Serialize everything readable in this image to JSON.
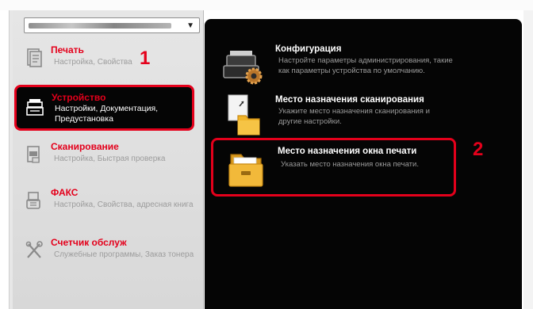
{
  "device_dropdown": {
    "value": "",
    "arrow": "▼"
  },
  "nav": {
    "items": [
      {
        "id": "print",
        "title": "Печать",
        "subtitle": "Настройка, Свойства"
      },
      {
        "id": "device",
        "title": "Устройство",
        "subtitle": "Настройки, Документация, Предустановка"
      },
      {
        "id": "scan",
        "title": "Сканирование",
        "subtitle": "Настройка, Быстрая проверка"
      },
      {
        "id": "fax",
        "title": "ФАКС",
        "subtitle": "Настройка, Свойства, адресная книга"
      },
      {
        "id": "counter",
        "title": "Счетчик обслуж",
        "subtitle": "Служебные программы, Заказ тонера"
      }
    ],
    "selected": "device"
  },
  "main": {
    "cards": [
      {
        "id": "configuration",
        "title": "Конфигурация",
        "description": "Настройте параметры администрирования, такие как параметры устройства по умолчанию."
      },
      {
        "id": "scan_destination",
        "title": "Место назначения сканирования",
        "description": "Укажите место назначения сканирования и другие настройки."
      },
      {
        "id": "print_box_destination",
        "title": "Место назначения окна печати",
        "description": "Указать место назначения окна печати."
      }
    ]
  },
  "annotations": {
    "step1": "1",
    "step2": "2"
  },
  "colors": {
    "accent": "#e4001b",
    "panel_bg": "#050505",
    "nav_bg": "#dcdcdc"
  }
}
